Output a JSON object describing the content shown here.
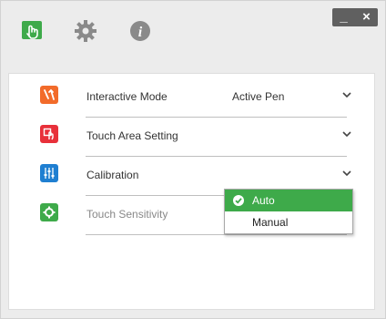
{
  "window": {
    "minimize_label": "_",
    "close_label": "×"
  },
  "toolbar": {
    "icons": [
      "touch-icon",
      "gear-icon",
      "info-icon"
    ],
    "active_color": "#3eaa4a"
  },
  "settings": [
    {
      "label": "Interactive Mode",
      "value": "Active Pen",
      "icon": "interactive-mode-icon",
      "color": "#f26b2a",
      "enabled": true
    },
    {
      "label": "Touch Area Setting",
      "value": "",
      "icon": "touch-area-icon",
      "color": "#e8303a",
      "enabled": true
    },
    {
      "label": "Calibration",
      "value": "",
      "icon": "calibration-icon",
      "color": "#1f7fd1",
      "enabled": true
    },
    {
      "label": "Touch Sensitivity",
      "value": "",
      "icon": "touch-sensitivity-icon",
      "color": "#3eaa4a",
      "enabled": false
    }
  ],
  "calibration_dropdown": {
    "options": [
      "Auto",
      "Manual"
    ],
    "selected": "Auto"
  }
}
